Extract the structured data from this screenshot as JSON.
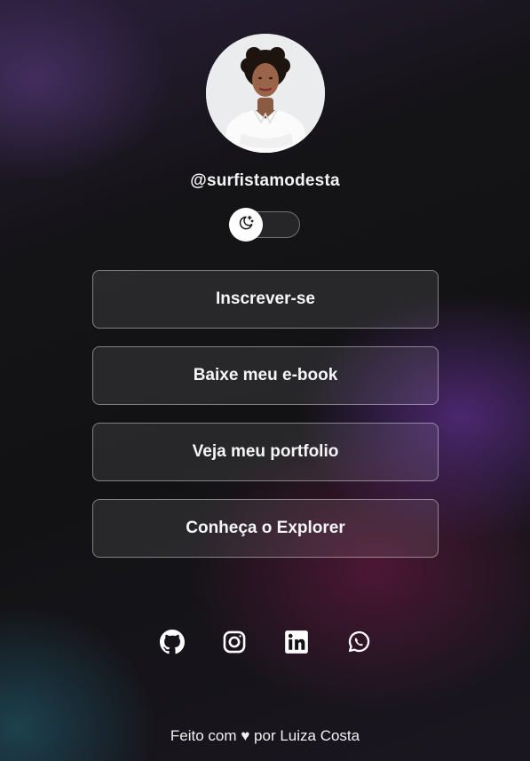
{
  "profile": {
    "username": "@surfistamodesta",
    "avatar_alt": "avatar"
  },
  "theme_toggle": {
    "icon": "moon-stars-icon",
    "state": "dark"
  },
  "links": [
    {
      "label": "Inscrever-se"
    },
    {
      "label": "Baixe meu e-book"
    },
    {
      "label": "Veja meu portfolio"
    },
    {
      "label": "Conheça o Explorer"
    }
  ],
  "social": [
    {
      "icon": "github-icon"
    },
    {
      "icon": "instagram-icon"
    },
    {
      "icon": "linkedin-icon"
    },
    {
      "icon": "whatsapp-icon"
    }
  ],
  "footer": {
    "text": "Feito com ♥ por Luiza Costa"
  },
  "colors": {
    "background": "#121214",
    "accent_purple": "#5f2d8c",
    "text": "#ffffff"
  }
}
